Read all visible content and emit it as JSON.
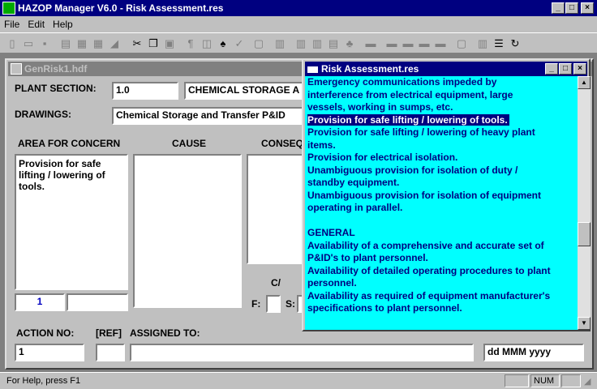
{
  "app": {
    "title": "HAZOP Manager V6.0 - Risk Assessment.res"
  },
  "title_buttons": {
    "minimize": "_",
    "maximize": "□",
    "close": "×"
  },
  "menu": {
    "items": [
      "File",
      "Edit",
      "Help"
    ]
  },
  "toolbar": {
    "icons": [
      "new-icon",
      "open-icon",
      "save-icon",
      "sheet-icon",
      "table-icon",
      "grid-icon",
      "chart-icon",
      "cut-icon",
      "copy-icon",
      "paste-icon",
      "find-icon",
      "record-icon",
      "binoculars-icon",
      "spell-icon",
      "window-icon",
      "form1-icon",
      "form2-icon",
      "form3-icon",
      "form4-icon",
      "tree-icon",
      "panel1-icon",
      "panel2-icon",
      "panel3-icon",
      "panel4-icon",
      "panel5-icon",
      "layout1-icon",
      "layout2-icon",
      "refresh-icon"
    ]
  },
  "child": {
    "title": "GenRisk1.hdf",
    "plant_section_label": "PLANT SECTION:",
    "plant_section_value": "1.0",
    "plant_section_name": "CHEMICAL STORAGE A",
    "drawings_label": "DRAWINGS:",
    "drawings_value": "Chemical Storage and Transfer P&ID",
    "area_header": "AREA FOR CONCERN",
    "cause_header": "CAUSE",
    "conseq_header": "CONSEQ",
    "area_text": "Provision for safe lifting / lowering of tools.",
    "area_number": "1",
    "ca_label": "C/",
    "f_label": "F:",
    "s_label": "S:",
    "action_no_label": "ACTION NO:",
    "ref_label": "[REF]",
    "assigned_label": "ASSIGNED TO:",
    "action_no_value": "1",
    "date_value": "dd MMM yyyy"
  },
  "popup": {
    "title": "Risk Assessment.res",
    "lines": [
      "Emergency communications impeded by",
      "interference from electrical equipment, large",
      "vessels, working in sumps, etc.",
      "Provision for safe lifting / lowering of tools.",
      "Provision for safe lifting / lowering of heavy plant",
      "items.",
      "Provision for electrical isolation.",
      "Unambiguous provision for isolation of duty /",
      "standby equipment.",
      "Unambiguous provision for isolation of equipment",
      "operating in parallel.",
      "",
      "GENERAL",
      "Availability of a comprehensive and accurate set of",
      "P&ID's to plant personnel.",
      "Availability of detailed operating procedures to plant",
      "personnel.",
      "Availability as required of equipment manufacturer's",
      "specifications to plant personnel."
    ],
    "selected_index": 3
  },
  "status": {
    "help": "For Help, press F1",
    "num": "NUM"
  },
  "colors": {
    "title_active": "#000080",
    "popup_bg": "#00ffff",
    "face": "#c0c0c0"
  }
}
